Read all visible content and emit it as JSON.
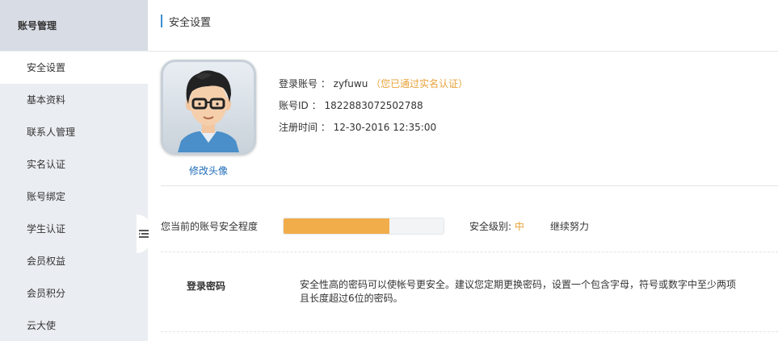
{
  "sidebar": {
    "header": "账号管理",
    "items": [
      {
        "label": "安全设置",
        "active": true
      },
      {
        "label": "基本资料"
      },
      {
        "label": "联系人管理"
      },
      {
        "label": "实名认证"
      },
      {
        "label": "账号绑定"
      },
      {
        "label": "学生认证"
      },
      {
        "label": "会员权益"
      },
      {
        "label": "会员积分"
      },
      {
        "label": "云大使"
      }
    ]
  },
  "main": {
    "title": "安全设置",
    "profile": {
      "change_avatar": "修改头像",
      "login_account_label": "登录账号 ：",
      "login_account_value": "zyfuwu",
      "verified_open": "（",
      "verified_text": "您已通过实名认证",
      "verified_close": "）",
      "account_id_label": "账号ID ：",
      "account_id_value": "1822883072502788",
      "reg_time_label": "注册时间 ：",
      "reg_time_value": "12-30-2016 12:35:00"
    },
    "security": {
      "label": "您当前的账号安全程度",
      "progress_fraction": 0.66,
      "level_label": "安全级别: ",
      "level_value": "中",
      "hint": "继续努力"
    },
    "password": {
      "label": "登录密码",
      "description": "安全性高的密码可以使帐号更安全。建议您定期更换密码，设置一个包含字母，符号或数字中至少两项且长度超过6位的密码。"
    }
  },
  "colors": {
    "accent_blue": "#3e8ed0",
    "link_blue": "#1e6bb8",
    "orange": "#e8a33a",
    "progress": "#f2ad4b"
  },
  "icons": {
    "collapse": "collapse-list-icon",
    "avatar": "user-avatar-cartoon"
  }
}
